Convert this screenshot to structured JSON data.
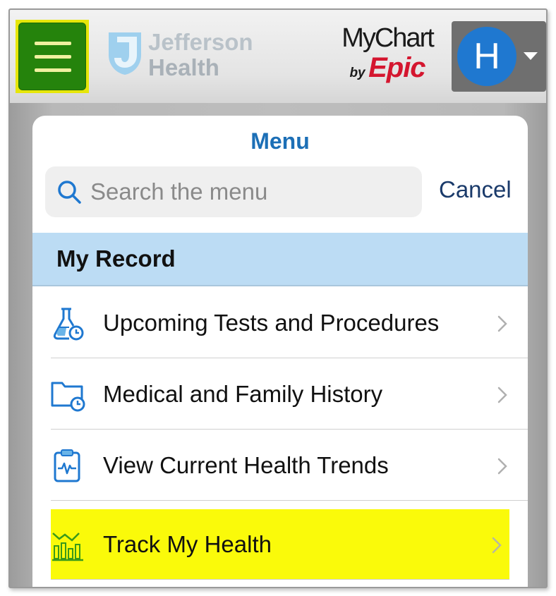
{
  "header": {
    "logo_line1": "Jefferson",
    "logo_line2": "Health",
    "mychart_text": "MyChart",
    "mychart_by": "by",
    "mychart_epic": "Epic",
    "avatar_initial": "H"
  },
  "menu": {
    "title": "Menu",
    "search_placeholder": "Search the menu",
    "cancel_label": "Cancel",
    "section_title": "My Record",
    "items": [
      {
        "label": "Upcoming Tests and Procedures",
        "icon": "flask-clock-icon"
      },
      {
        "label": "Medical and Family History",
        "icon": "folder-clock-icon"
      },
      {
        "label": "View Current Health Trends",
        "icon": "clipboard-pulse-icon"
      },
      {
        "label": "Track My Health",
        "icon": "bar-chart-trend-icon",
        "highlighted": true
      }
    ]
  },
  "colors": {
    "hamburger_bg": "#25830c",
    "highlight_yellow": "#fafa0a",
    "menu_title": "#1c6fb6",
    "section_bg": "#bcdcf4",
    "avatar_bg": "#1f78d0",
    "epic_red": "#d4162f",
    "icon_blue": "#1f78d0",
    "track_icon_green": "#3a9a1a"
  }
}
